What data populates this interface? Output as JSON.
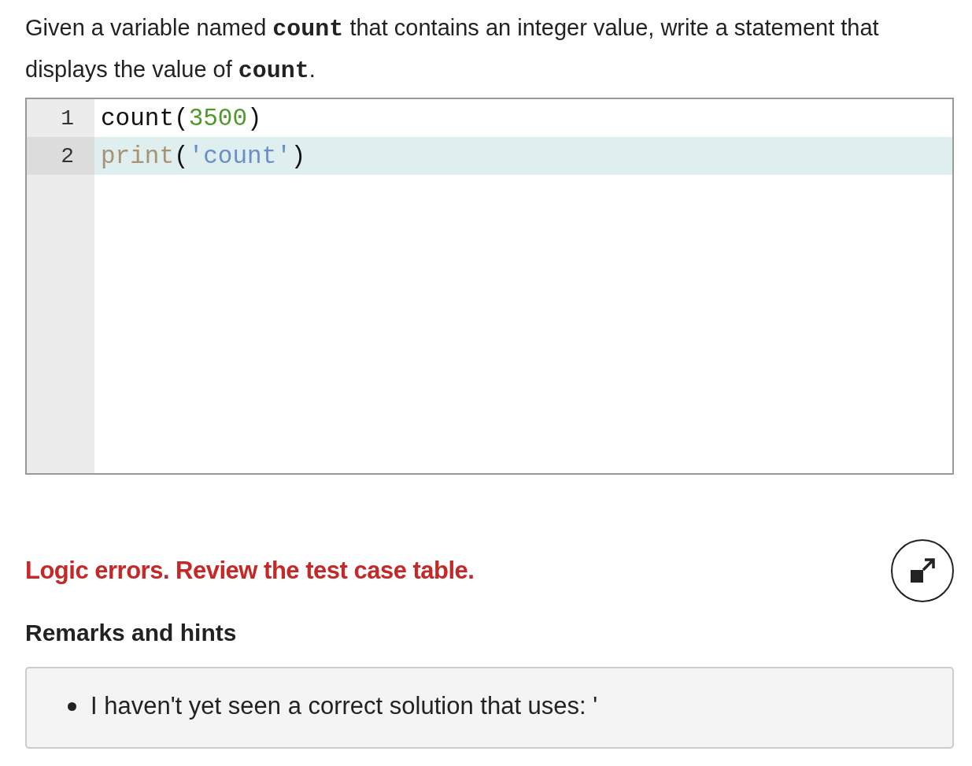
{
  "prompt": [
    {
      "kind": "text",
      "text": "Given a variable named "
    },
    {
      "kind": "code",
      "text": "count"
    },
    {
      "kind": "text",
      "text": " that contains an integer value, write a statement that displays the value of "
    },
    {
      "kind": "code",
      "text": "count"
    },
    {
      "kind": "text",
      "text": "."
    }
  ],
  "editor": {
    "lines": [
      {
        "number": "1",
        "active": false,
        "tokens": [
          {
            "kind": "plain",
            "text": "count"
          },
          {
            "kind": "plain",
            "text": "("
          },
          {
            "kind": "number",
            "text": "3500"
          },
          {
            "kind": "plain",
            "text": ")"
          }
        ]
      },
      {
        "number": "2",
        "active": true,
        "tokens": [
          {
            "kind": "builtin",
            "text": "print"
          },
          {
            "kind": "plain",
            "text": "("
          },
          {
            "kind": "string",
            "text": "'count'"
          },
          {
            "kind": "plain",
            "text": ")"
          }
        ]
      }
    ]
  },
  "result": {
    "message": "Logic errors. Review the test case table."
  },
  "remarks": {
    "heading": "Remarks and hints",
    "items": [
      "I haven't yet seen a correct solution that uses: '"
    ]
  }
}
